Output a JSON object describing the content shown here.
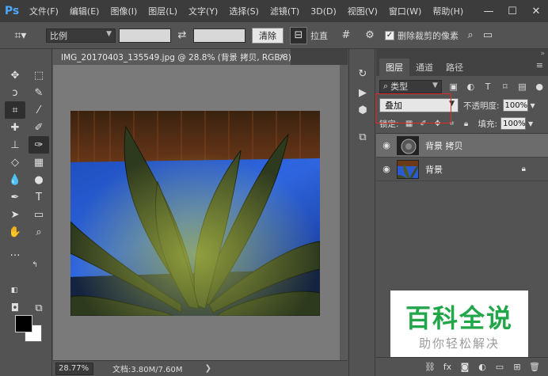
{
  "app": {
    "logo": "Ps",
    "menu": [
      "文件(F)",
      "编辑(E)",
      "图像(I)",
      "图层(L)",
      "文字(Y)",
      "选择(S)",
      "滤镜(T)",
      "3D(D)",
      "视图(V)",
      "窗口(W)",
      "帮助(H)"
    ],
    "window_controls": {
      "minimize": "—",
      "maximize": "☐",
      "close": "✕"
    }
  },
  "options_bar": {
    "ratio_select": "比例",
    "clear_button": "清除",
    "straighten_label": "拉直",
    "delete_cropped_label": "删除裁剪的像素",
    "delete_cropped_checked": true
  },
  "document": {
    "tab_title": "IMG_20170403_135549.jpg @ 28.8% (背景 拷贝, RGB/8) *",
    "zoom": "28.77%",
    "doc_info": "文档:3.80M/7.60M"
  },
  "layers_panel": {
    "tabs": [
      "图层",
      "通道",
      "路径"
    ],
    "active_tab": "图层",
    "filter_type": "类型",
    "blend_mode": "叠加",
    "opacity_label": "不透明度:",
    "opacity_value": "100%",
    "lock_label": "锁定:",
    "fill_label": "填充:",
    "fill_value": "100%",
    "layers": [
      {
        "name": "背景 拷贝",
        "selected": true,
        "locked": false
      },
      {
        "name": "背景",
        "selected": false,
        "locked": true
      }
    ]
  },
  "watermark": {
    "title": "百科全说",
    "subtitle": "助你轻松解决"
  },
  "colors": {
    "accent_ps": "#4aa8ff",
    "highlight_box": "#e02a2a",
    "watermark_green": "#21a64a"
  }
}
